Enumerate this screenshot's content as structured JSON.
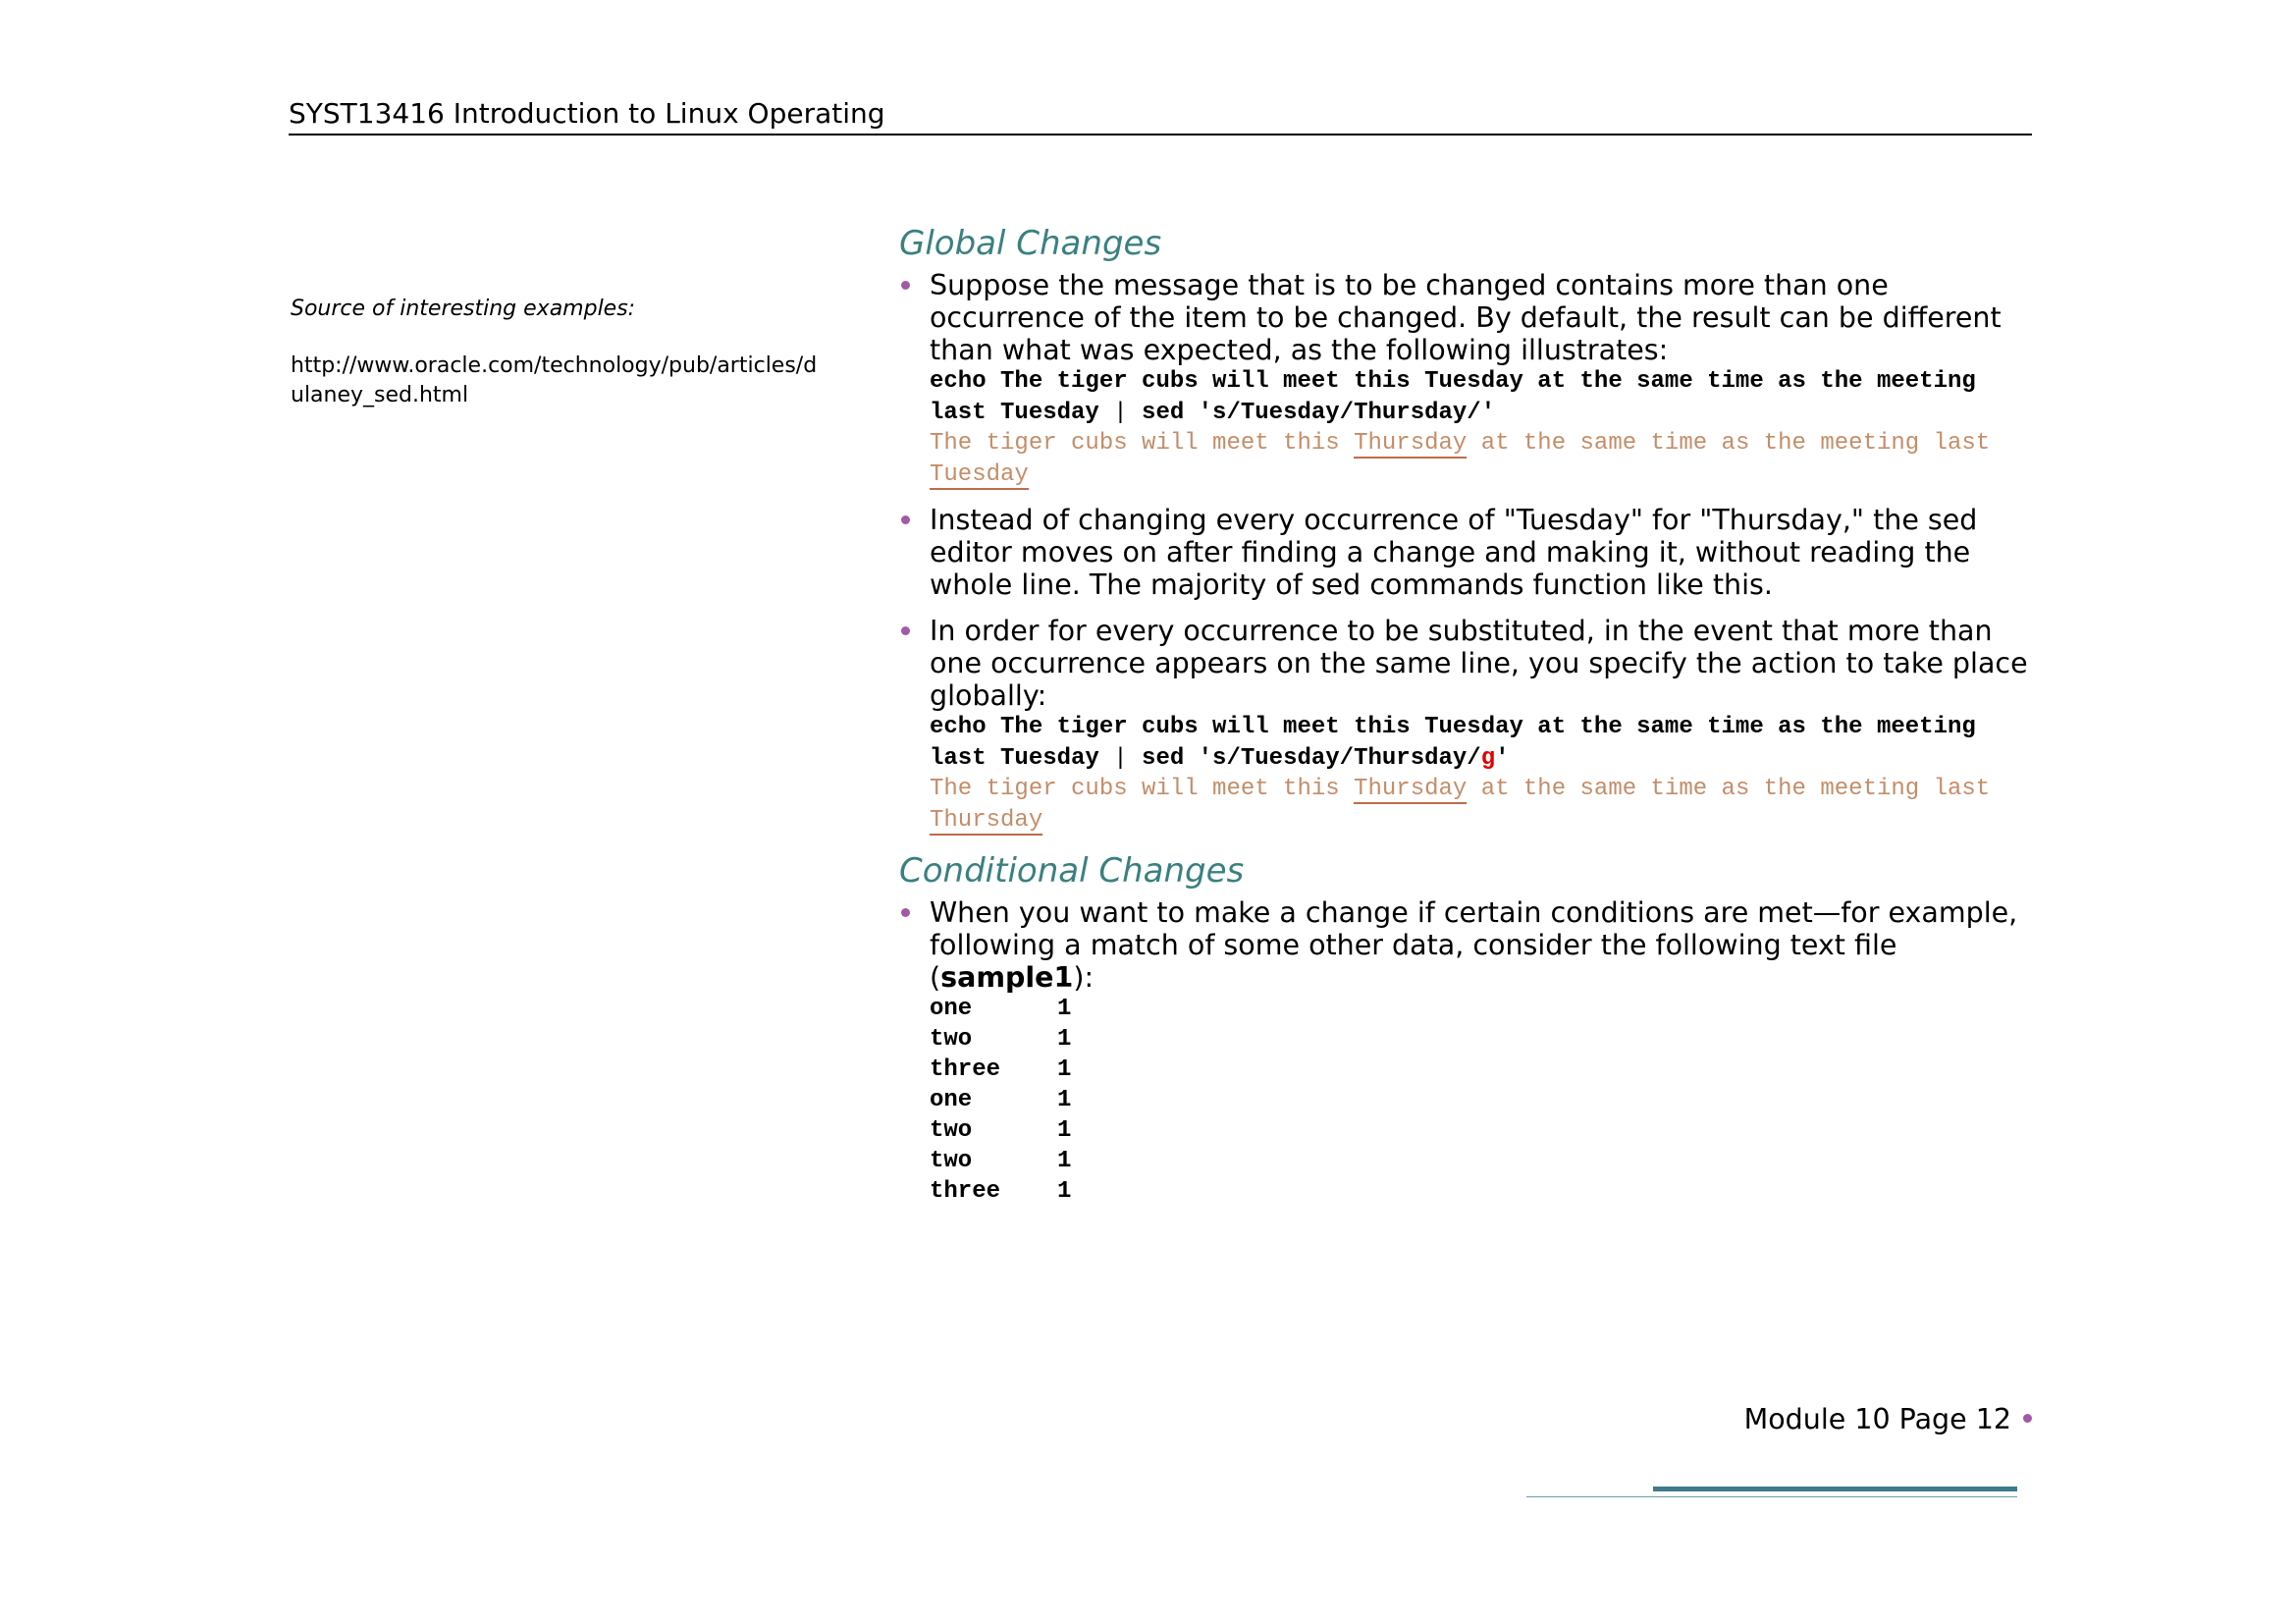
{
  "header": {
    "title": "SYST13416 Introduction to Linux Operating"
  },
  "sidebar": {
    "note": "Source of interesting examples:",
    "url": "http://www.oracle.com/technology/pub/articles/dulaney_sed.html"
  },
  "sections": [
    {
      "title": "Global Changes",
      "bullets": [
        {
          "text": "Suppose the message that is to be changed contains more than one occurrence of the item to be changed. By default, the result can be different than what was expected, as the following illustrates:",
          "code_before_pipe": "echo The tiger cubs will meet this Tuesday at the same time as the meeting last Tuesday ",
          "code_pipe": "|",
          "code_after_pipe": " sed 's/Tuesday/Thursday/'",
          "output_part1": "The tiger cubs will meet this ",
          "output_word1": "Thursday",
          "output_part2": " at the same time as the meeting last ",
          "output_word2": "Tuesday"
        },
        {
          "text": "Instead of changing every occurrence of \"Tuesday\" for \"Thursday,\" the sed editor moves on after finding a change and making it, without reading the whole line. The majority of sed commands function like this."
        },
        {
          "text": "In order for every occurrence to be substituted, in the event that more than one occurrence appears on the same line, you specify the action to take place globally:",
          "code_before_pipe": "echo The tiger cubs will meet this Tuesday at the same time as the meeting last Tuesday ",
          "code_pipe": "|",
          "code_after_pipe": " sed 's/Tuesday/Thursday/",
          "code_flag": "g",
          "code_end": "'",
          "output_part1": "The tiger cubs will meet this ",
          "output_word1": "Thursday",
          "output_part2": " at the same time as the meeting last ",
          "output_word2": "Thursday"
        }
      ]
    },
    {
      "title": "Conditional Changes",
      "bullets": [
        {
          "text_before": "When you want to make a change if certain conditions are met—for example, following a match of some other data, consider the following text file (",
          "text_bold": "sample1",
          "text_after": "):",
          "rows": [
            {
              "word": "one",
              "num": "1"
            },
            {
              "word": "two",
              "num": "1"
            },
            {
              "word": "three",
              "num": "1"
            },
            {
              "word": "one",
              "num": "1"
            },
            {
              "word": "two",
              "num": "1"
            },
            {
              "word": "two",
              "num": "1"
            },
            {
              "word": "three",
              "num": "1"
            }
          ]
        }
      ]
    }
  ],
  "footer": {
    "page_label": "Module 10 Page 12"
  },
  "colors": {
    "heading": "#3a8080",
    "bullet": "#a25aa6",
    "output_text": "#c48d68",
    "flag_red": "#e00000",
    "footer_bar": "#3f7c8a"
  }
}
